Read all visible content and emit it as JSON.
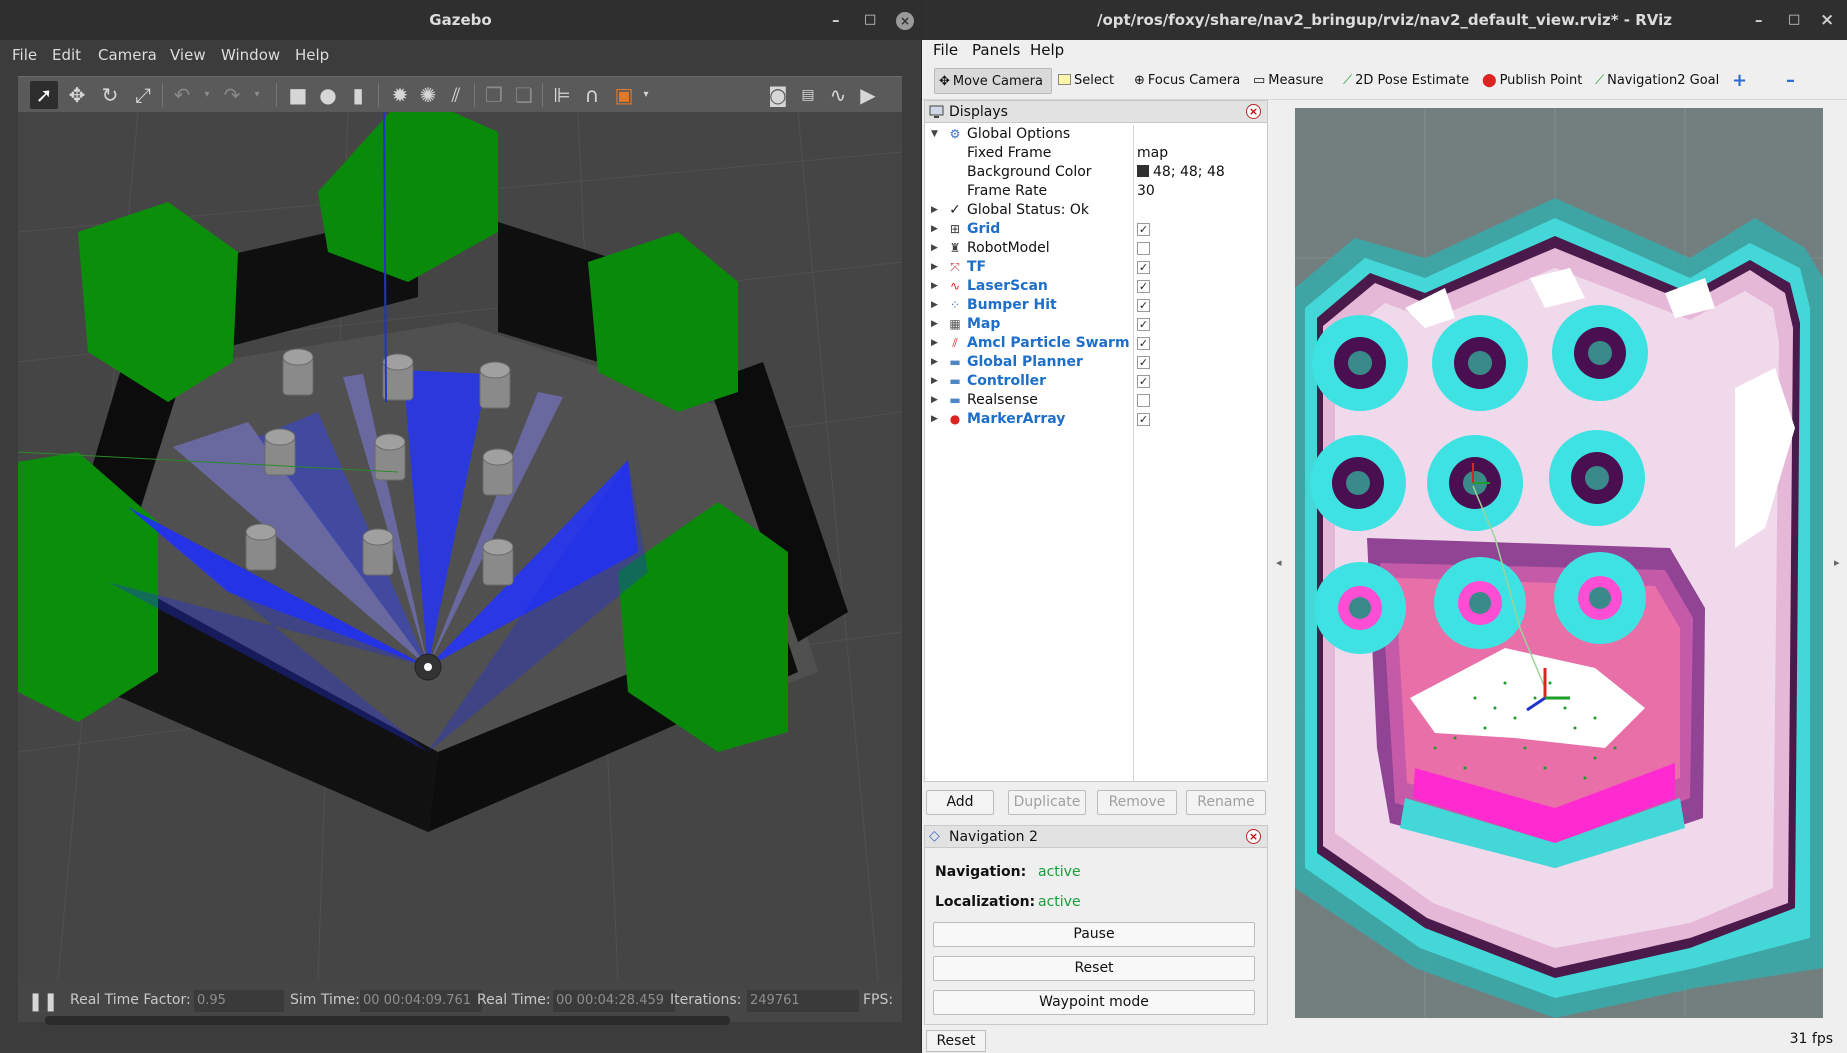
{
  "gazebo": {
    "title": "Gazebo",
    "window_controls": {
      "minimize": "–",
      "maximize": "□",
      "close": "×"
    },
    "menu": [
      "File",
      "Edit",
      "Camera",
      "View",
      "Window",
      "Help"
    ],
    "toolbar_icons": [
      "select-mode",
      "translate-mode",
      "rotate-mode",
      "scale-mode",
      "undo",
      "redo",
      "box-shape",
      "sphere-shape",
      "cylinder-shape",
      "point-light",
      "spot-light",
      "directional-light",
      "copy",
      "paste",
      "align",
      "snap",
      "change-view",
      "screenshot",
      "log",
      "plot",
      "record-video"
    ],
    "status": {
      "real_time_factor_label": "Real Time Factor:",
      "real_time_factor": "0.95",
      "sim_time_label": "Sim Time:",
      "sim_time": "00 00:04:09.761",
      "real_time_label": "Real Time:",
      "real_time": "00 00:04:28.459",
      "iterations_label": "Iterations:",
      "iterations": "249761",
      "fps_label": "FPS:"
    }
  },
  "rviz": {
    "title": "/opt/ros/foxy/share/nav2_bringup/rviz/nav2_default_view.rviz* - RViz",
    "window_controls": {
      "minimize": "–",
      "maximize": "□",
      "close": "×"
    },
    "menu": [
      "File",
      "Panels",
      "Help"
    ],
    "toolbar": {
      "move_camera": "Move Camera",
      "select": "Select",
      "focus_camera": "Focus Camera",
      "measure": "Measure",
      "pose_estimate": "2D Pose Estimate",
      "publish_point": "Publish Point",
      "nav2_goal": "Navigation2 Goal",
      "plus": "+",
      "minus": "–"
    },
    "displays": {
      "title": "Displays",
      "global_options": "Global Options",
      "fixed_frame_label": "Fixed Frame",
      "fixed_frame": "map",
      "background_color_label": "Background Color",
      "background_color": "48; 48; 48",
      "background_color_hex": "#303030",
      "frame_rate_label": "Frame Rate",
      "frame_rate": "30",
      "global_status": "Global Status: Ok",
      "items": [
        {
          "name": "Grid",
          "checked": true,
          "blue": true
        },
        {
          "name": "RobotModel",
          "checked": false,
          "blue": false
        },
        {
          "name": "TF",
          "checked": true,
          "blue": true
        },
        {
          "name": "LaserScan",
          "checked": true,
          "blue": true
        },
        {
          "name": "Bumper Hit",
          "checked": true,
          "blue": true
        },
        {
          "name": "Map",
          "checked": true,
          "blue": true
        },
        {
          "name": "Amcl Particle Swarm",
          "checked": true,
          "blue": true
        },
        {
          "name": "Global Planner",
          "checked": true,
          "blue": true
        },
        {
          "name": "Controller",
          "checked": true,
          "blue": true
        },
        {
          "name": "Realsense",
          "checked": false,
          "blue": false
        },
        {
          "name": "MarkerArray",
          "checked": true,
          "blue": true
        }
      ],
      "buttons": {
        "add": "Add",
        "duplicate": "Duplicate",
        "remove": "Remove",
        "rename": "Rename"
      }
    },
    "navigation": {
      "title": "Navigation 2",
      "navigation_label": "Navigation:",
      "navigation_status": "active",
      "localization_label": "Localization:",
      "localization_status": "active",
      "pause": "Pause",
      "reset": "Reset",
      "waypoint": "Waypoint mode"
    },
    "bottom": {
      "reset": "Reset",
      "fps": "31 fps"
    }
  }
}
